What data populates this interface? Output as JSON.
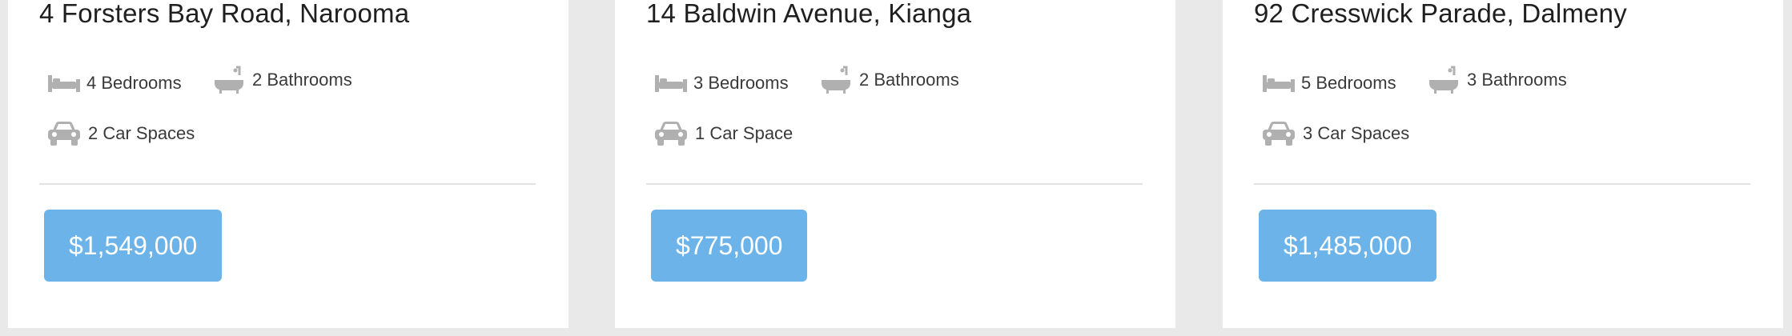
{
  "listings": [
    {
      "address": "4 Forsters Bay Road, Narooma",
      "bedrooms": "4 Bedrooms",
      "bathrooms": "2 Bathrooms",
      "car_spaces": "2 Car Spaces",
      "price": "$1,549,000"
    },
    {
      "address": "14 Baldwin Avenue, Kianga",
      "bedrooms": "3 Bedrooms",
      "bathrooms": "2 Bathrooms",
      "car_spaces": "1 Car Space",
      "price": "$775,000"
    },
    {
      "address": "92 Cresswick Parade, Dalmeny",
      "bedrooms": "5 Bedrooms",
      "bathrooms": "3 Bathrooms",
      "car_spaces": "3 Car Spaces",
      "price": "$1,485,000"
    }
  ],
  "colors": {
    "price_button": "#6bb3e8",
    "icon": "#b0b0b0",
    "background": "#e9e9e9"
  },
  "icons": {
    "bed": "bed-icon",
    "bath": "bathtub-icon",
    "car": "car-icon"
  }
}
